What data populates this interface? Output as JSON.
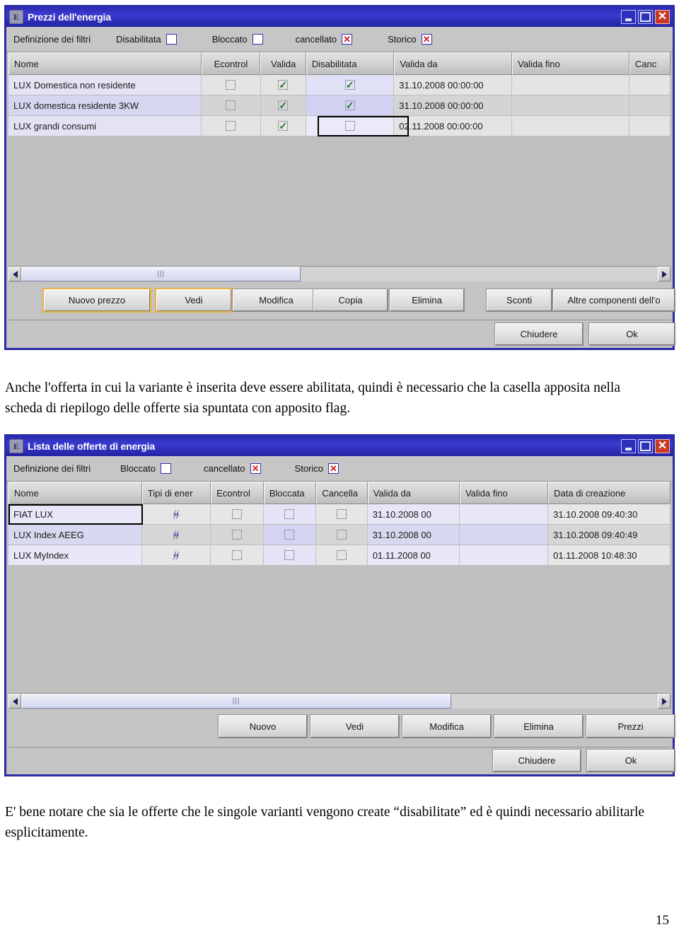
{
  "page": {
    "number": "15"
  },
  "window1": {
    "title": "Prezzi dell'energia",
    "app_icon_letter": "E",
    "controls": {
      "minimize": "minimize",
      "maximize": "maximize",
      "close": "close"
    },
    "filters": {
      "label": "Definizione dei filtri",
      "items": [
        {
          "label": "Disabilitata",
          "state": "unchecked"
        },
        {
          "label": "Bloccato",
          "state": "unchecked"
        },
        {
          "label": "cancellato",
          "state": "x"
        },
        {
          "label": "Storico",
          "state": "x"
        }
      ]
    },
    "table": {
      "columns": [
        "Nome",
        "Econtrol",
        "Valida",
        "Disabilitata",
        "Valida da",
        "Valida fino",
        "Canc"
      ],
      "rows": [
        {
          "nome": "LUX Domestica non residente",
          "econtrol": false,
          "valida": true,
          "disabilitata": true,
          "valida_da": "31.10.2008 00:00:00",
          "valida_fino": "",
          "canc": ""
        },
        {
          "nome": "LUX domestica residente 3KW",
          "econtrol": false,
          "valida": true,
          "disabilitata": true,
          "valida_da": "31.10.2008 00:00:00",
          "valida_fino": "",
          "canc": ""
        },
        {
          "nome": "LUX grandi consumi",
          "econtrol": false,
          "valida": true,
          "disabilitata": false,
          "valida_da": "02.11.2008 00:00:00",
          "valida_fino": "",
          "canc": ""
        }
      ]
    },
    "buttons": {
      "primary": [
        "Nuovo prezzo",
        "Vedi",
        "Modifica",
        "Copia",
        "Elimina"
      ],
      "secondary": [
        "Sconti",
        "Altre componenti dell'o"
      ],
      "footer": [
        "Chiudere",
        "Ok"
      ]
    }
  },
  "paragraph1": "Anche l'offerta in cui la variante è inserita deve essere abilitata, quindi è  necessario che la casella apposita nella scheda di riepilogo delle offerte sia spuntata con apposito flag.",
  "window2": {
    "title": "Lista delle offerte di energia",
    "app_icon_letter": "E",
    "controls": {
      "minimize": "minimize",
      "maximize": "maximize",
      "close": "close"
    },
    "filters": {
      "label": "Definizione dei filtri",
      "items": [
        {
          "label": "Bloccato",
          "state": "unchecked"
        },
        {
          "label": "cancellato",
          "state": "x"
        },
        {
          "label": "Storico",
          "state": "x"
        }
      ]
    },
    "table": {
      "columns": [
        "Nome",
        "Tipi di ener",
        "Econtrol",
        "Bloccata",
        "Cancella",
        "Valida da",
        "Valida fino",
        "Data di creazione"
      ],
      "rows": [
        {
          "nome": "FIAT LUX",
          "tipi_di_ener": "energy-bolt-icon",
          "econtrol": false,
          "bloccata": false,
          "cancella": false,
          "valida_da": "31.10.2008 00",
          "valida_fino": "",
          "data_di_creazione": "31.10.2008 09:40:30"
        },
        {
          "nome": "LUX Index AEEG",
          "tipi_di_ener": "energy-bolt-icon",
          "econtrol": false,
          "bloccata": false,
          "cancella": false,
          "valida_da": "31.10.2008 00",
          "valida_fino": "",
          "data_di_creazione": "31.10.2008 09:40:49"
        },
        {
          "nome": "LUX MyIndex",
          "tipi_di_ener": "energy-bolt-icon",
          "econtrol": false,
          "bloccata": false,
          "cancella": false,
          "valida_da": "01.11.2008 00",
          "valida_fino": "",
          "data_di_creazione": "01.11.2008 10:48:30"
        }
      ]
    },
    "buttons": {
      "primary": [
        "Nuovo",
        "Vedi",
        "Modifica",
        "Elimina",
        "Prezzi"
      ],
      "footer": [
        "Chiudere",
        "Ok"
      ]
    }
  },
  "paragraph2": "E' bene notare che sia le offerte che le singole varianti vengono create “disabilitate” ed è quindi necessario abilitarle esplicitamente."
}
